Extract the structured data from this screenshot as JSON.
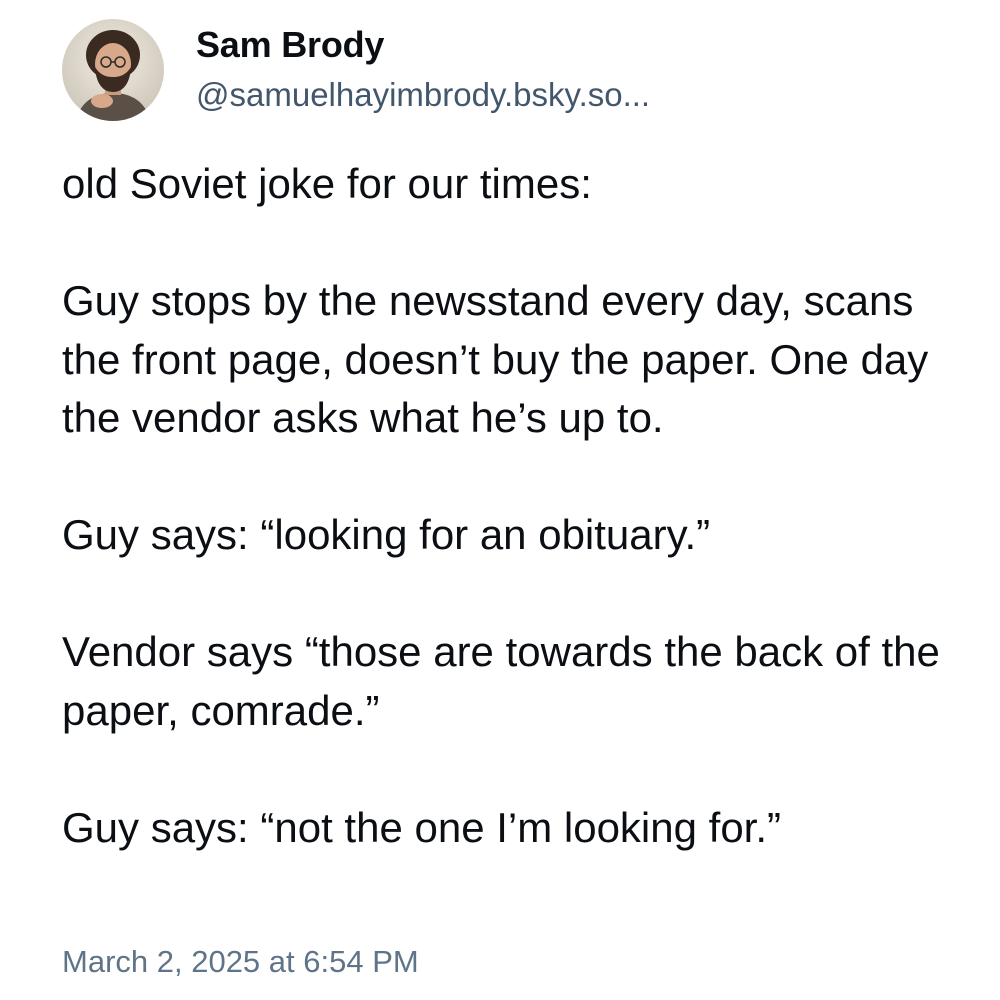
{
  "post": {
    "author": {
      "display_name": "Sam Brody",
      "handle": "@samuelhayimbrody.bsky.so..."
    },
    "avatar_icon": "avatar-photo-icon",
    "paragraphs": [
      "old Soviet joke for our times:",
      "Guy stops by the newsstand every day, scans the front page, doesn’t buy the paper. One day the vendor asks what he’s up to.",
      "Guy says: “looking for an obituary.”",
      "Vendor says “those are towards the back of the paper, comrade.”",
      "Guy says: “not the one I’m looking for.”"
    ],
    "timestamp": "March 2, 2025 at 6:54 PM"
  },
  "colors": {
    "text": "#0b0f14",
    "handle": "#42576c",
    "timestamp": "#5f7489",
    "background": "#ffffff"
  }
}
